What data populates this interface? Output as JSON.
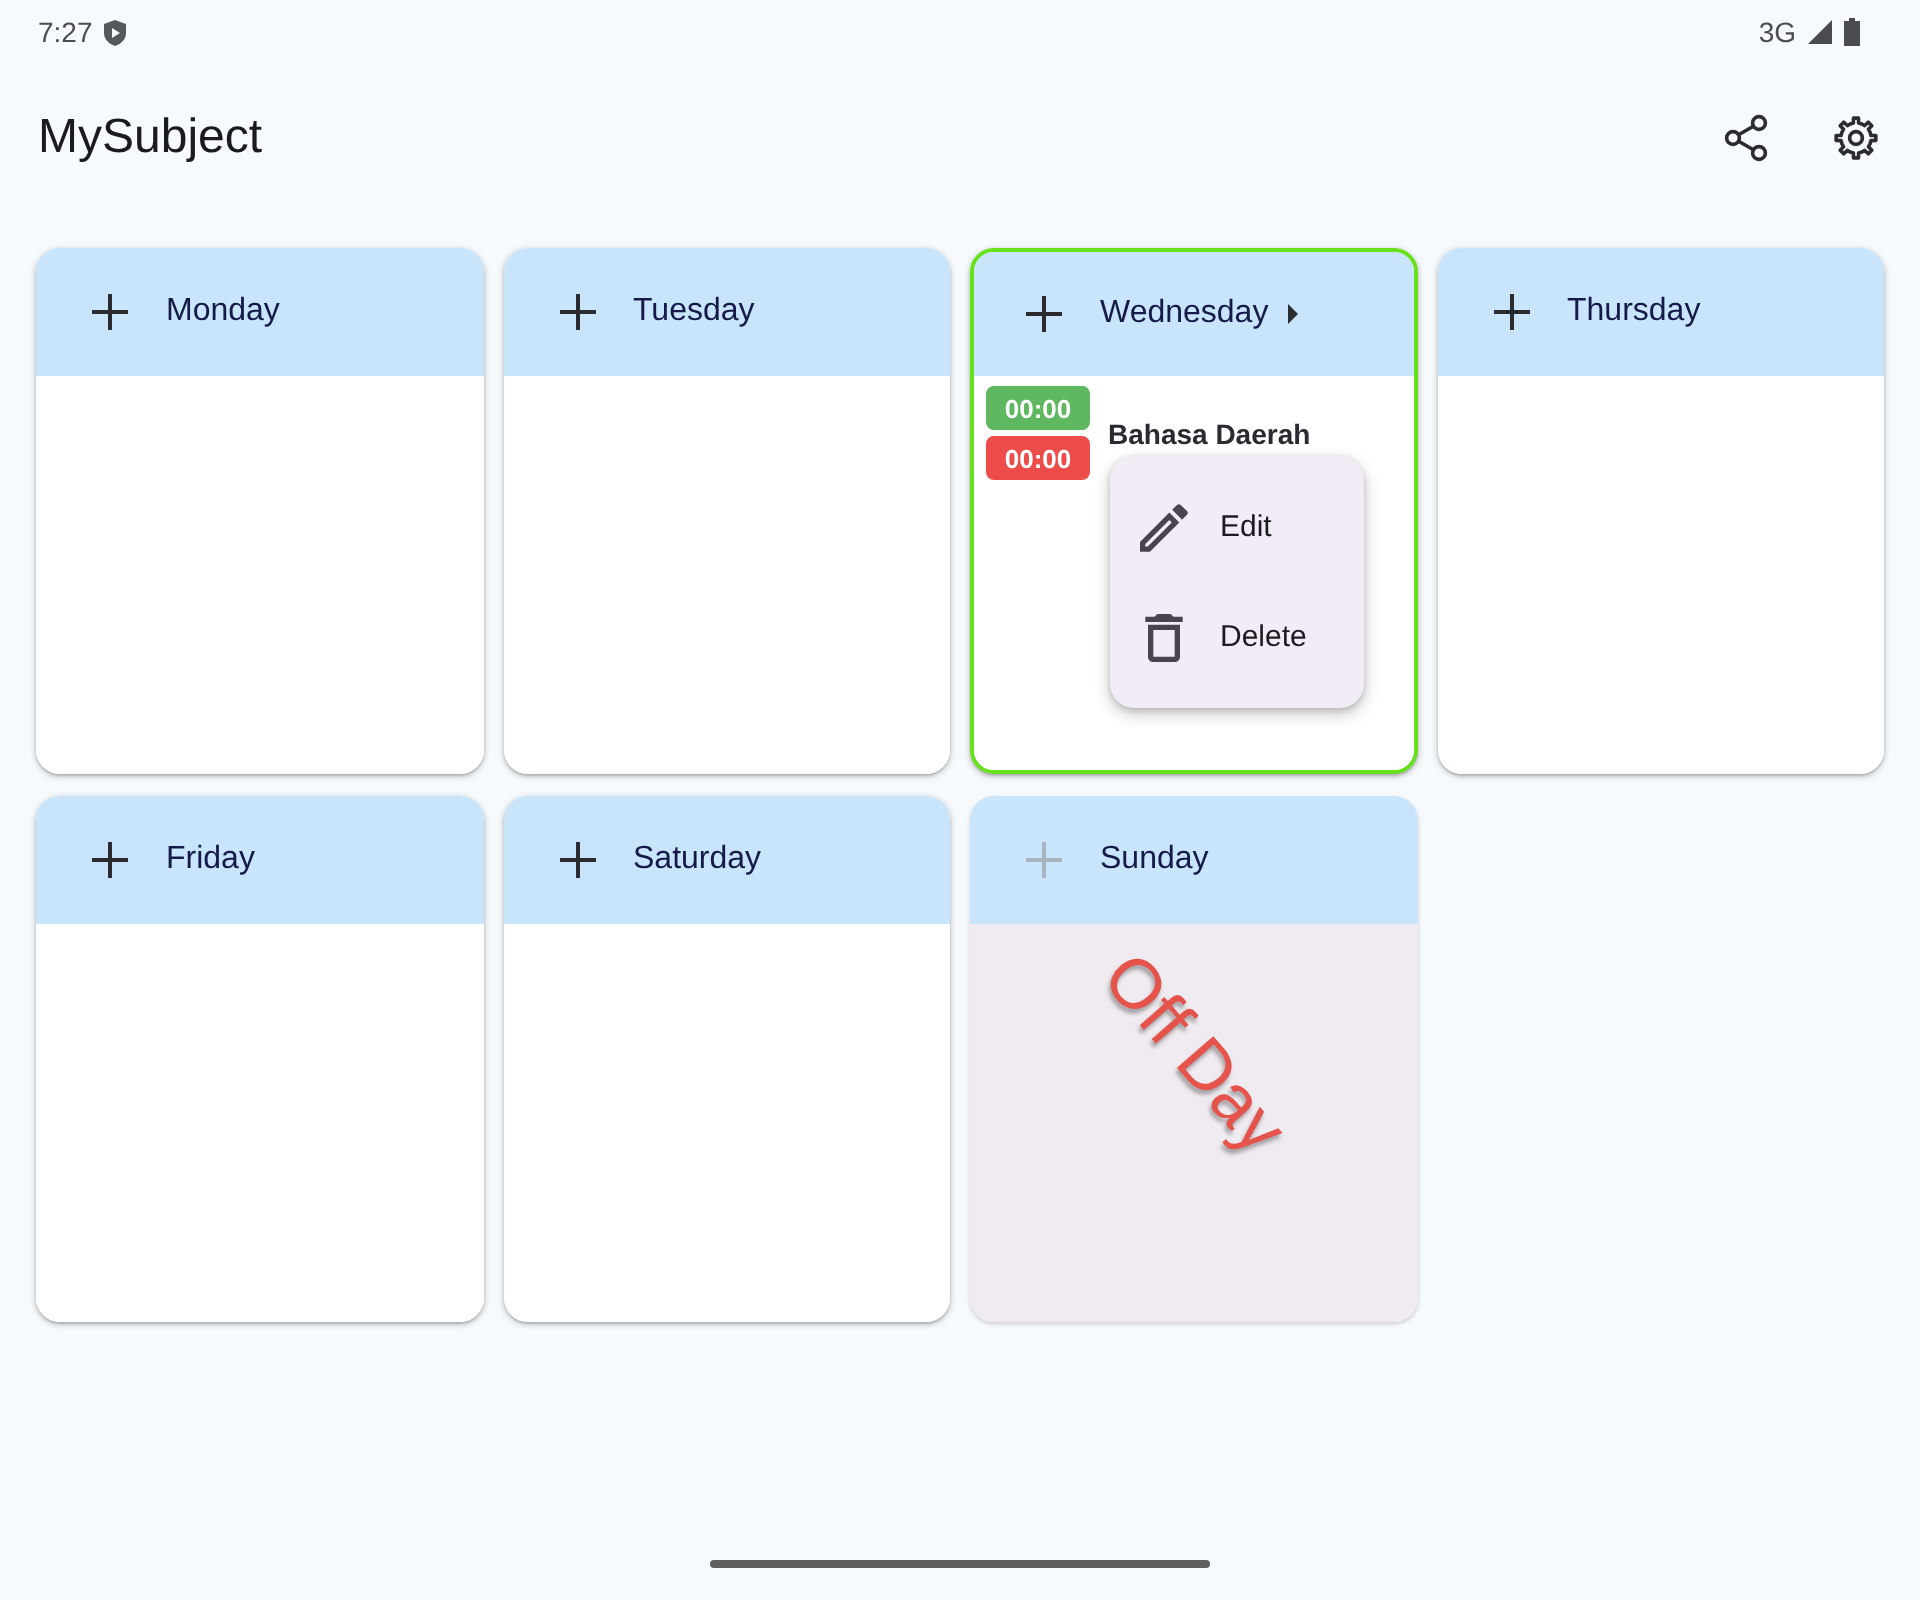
{
  "status_bar": {
    "time": "7:27",
    "network": "3G"
  },
  "app_bar": {
    "title": "MySubject"
  },
  "days": [
    {
      "name": "Monday",
      "selected": false,
      "off_day": false
    },
    {
      "name": "Tuesday",
      "selected": false,
      "off_day": false
    },
    {
      "name": "Wednesday",
      "selected": true,
      "off_day": false,
      "subjects": [
        {
          "start": "00:00",
          "end": "00:00",
          "name": "Bahasa Daerah",
          "menu": [
            {
              "kind": "edit",
              "label": "Edit"
            },
            {
              "kind": "delete",
              "label": "Delete"
            }
          ]
        }
      ]
    },
    {
      "name": "Thursday",
      "selected": false,
      "off_day": false
    },
    {
      "name": "Friday",
      "selected": false,
      "off_day": false
    },
    {
      "name": "Saturday",
      "selected": false,
      "off_day": false
    },
    {
      "name": "Sunday",
      "selected": false,
      "off_day": true,
      "off_label": "Off Day"
    }
  ]
}
